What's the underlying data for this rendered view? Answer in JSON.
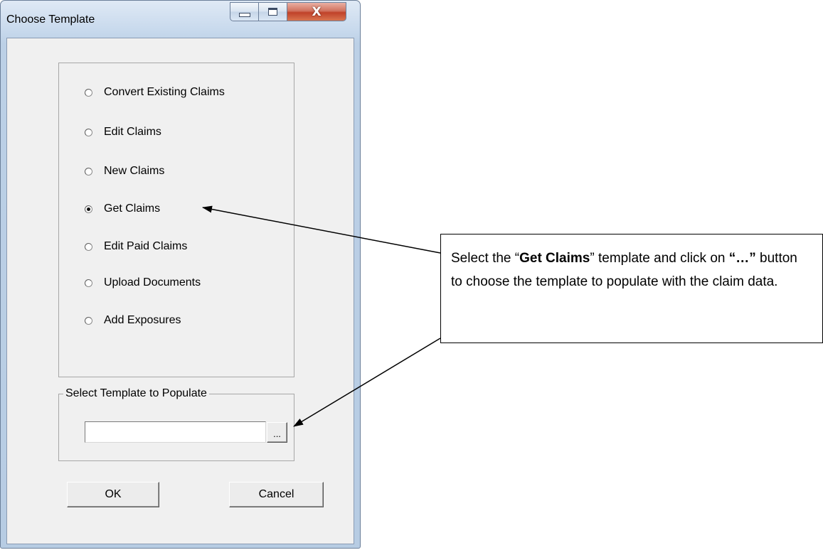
{
  "window": {
    "title": "Choose Template",
    "close_glyph": "X"
  },
  "options": [
    {
      "label": "Convert Existing Claims",
      "checked": false
    },
    {
      "label": "Edit Claims",
      "checked": false
    },
    {
      "label": "New Claims",
      "checked": false
    },
    {
      "label": "Get Claims",
      "checked": true
    },
    {
      "label": "Edit Paid Claims",
      "checked": false
    },
    {
      "label": "Upload Documents",
      "checked": false
    },
    {
      "label": "Add Exposures",
      "checked": false
    }
  ],
  "template_group": {
    "legend": "Select Template to Populate",
    "path_value": "",
    "browse_label": "..."
  },
  "buttons": {
    "ok": "OK",
    "cancel": "Cancel"
  },
  "callout": {
    "part1": "Select the “",
    "bold1": "Get Claims",
    "part2": "” template and click on ",
    "bold2": "“…”",
    "part3": " button to choose the template to populate with the claim data."
  }
}
